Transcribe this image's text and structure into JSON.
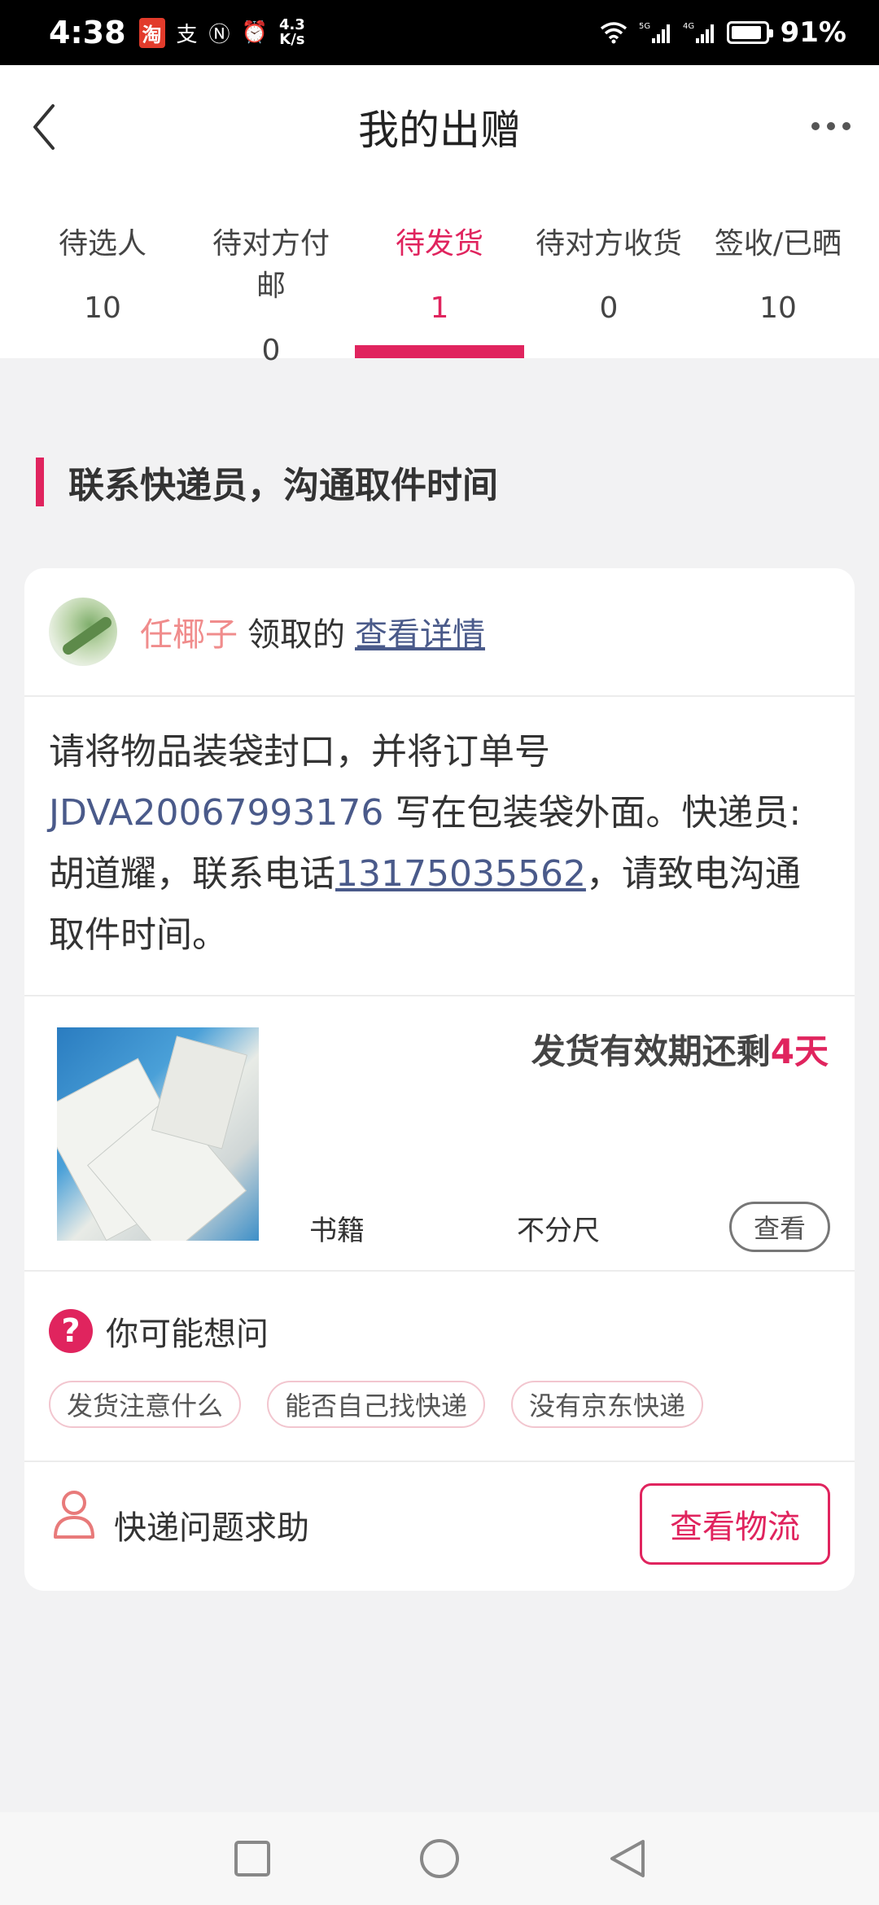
{
  "status_bar": {
    "time": "4:38",
    "app_badge": "淘",
    "speed_value": "4.3",
    "speed_unit": "K/s",
    "battery_text": "91%",
    "battery_level": 0.91
  },
  "header": {
    "title": "我的出赠"
  },
  "tabs": [
    {
      "label": "待选人",
      "count": "10"
    },
    {
      "label": "待对方付邮",
      "count": "0"
    },
    {
      "label": "待发货",
      "count": "1"
    },
    {
      "label": "待对方收货",
      "count": "0"
    },
    {
      "label": "签收/已晒",
      "count": "10"
    }
  ],
  "active_tab_index": 2,
  "section": {
    "title": "联系快递员，沟通取件时间"
  },
  "receiver": {
    "name": "任椰子",
    "suffix": "领取的",
    "link": "查看详情"
  },
  "instructions": {
    "part1": "请将物品装袋封口，并将订单号 ",
    "order_no": "JDVA20067993176",
    "part2": " 写在包装袋外面。快递员:胡道耀，联系电话",
    "phone": "13175035562",
    "part3": "，请致电沟通取件时间。"
  },
  "product": {
    "deadline_prefix": "发货有效期还剩",
    "deadline_days": "4天",
    "category": "书籍",
    "size": "不分尺",
    "view_button": "查看"
  },
  "faq": {
    "title": "你可能想问",
    "chips": [
      "发货注意什么",
      "能否自己找快递",
      "没有京东快递"
    ]
  },
  "support": {
    "label": "快递问题求助",
    "logistics_button": "查看物流"
  },
  "colors": {
    "accent": "#e0245e",
    "link": "#4a5a8a",
    "receiver_name": "#f08c8c"
  }
}
